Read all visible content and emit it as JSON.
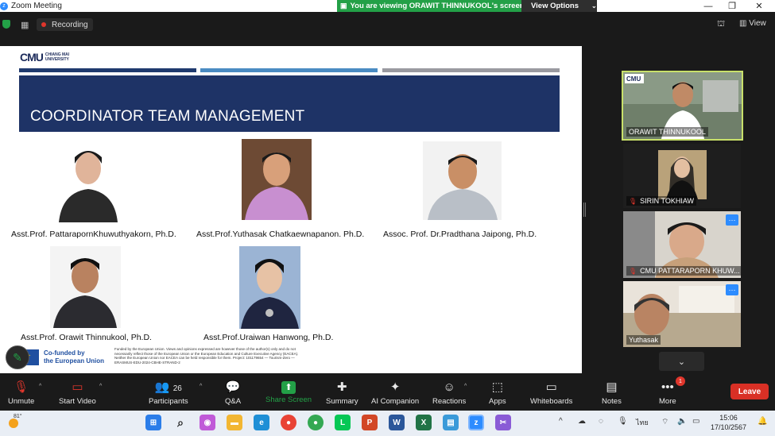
{
  "titlebar": {
    "title": "Zoom Meeting",
    "viewing_banner": "You are viewing ORAWIT THINNUKOOL's screen",
    "view_options": "View Options"
  },
  "topbar": {
    "recording": "Recording",
    "view_label": "View"
  },
  "slide": {
    "logo_mark": "CMU",
    "logo_text_line1": "CHIANG MAI",
    "logo_text_line2": "UNIVERSITY",
    "title": "COORDINATOR TEAM MANAGEMENT",
    "people": [
      {
        "name": "Asst.Prof. PattarapornKhuwuthyakorn, Ph.D."
      },
      {
        "name": "Asst.Prof.Yuthasak Chatkaewnapanon. Ph.D."
      },
      {
        "name": "Assoc. Prof. Dr.Pradthana Jaipong, Ph.D."
      },
      {
        "name": "Asst.Prof. Orawit Thinnukool, Ph.D."
      },
      {
        "name": "Asst.Prof.Uraiwan Hanwong, Ph.D."
      }
    ],
    "footer": {
      "cofunded_line1": "Co-funded by",
      "cofunded_line2": "the European Union",
      "disclaimer": "Funded by the European Union. Views and opinions expressed are however those of the author(s) only and do not necessarily reflect those of the European Union or the European Education and Culture Executive Agency (EACEA). Neither the European Union nor EACEA can be held responsible for them. Project: 101179654 — Tourism-Zero — ERASMUS-EDU-2024-CBHE-STRAND-2"
    }
  },
  "participants": [
    {
      "name": "ORAWIT THINNUKOOL",
      "muted": false,
      "active": true
    },
    {
      "name": "SIRIN TOKHIAW",
      "muted": true,
      "active": false
    },
    {
      "name": "CMU PATTARAPORN KHUW...",
      "muted": true,
      "active": false
    },
    {
      "name": "Yuthasak",
      "muted": false,
      "active": false
    }
  ],
  "toolbar": {
    "unmute": "Unmute",
    "start_video": "Start Video",
    "participants": "Participants",
    "participants_count": "26",
    "qa": "Q&A",
    "share_screen": "Share Screen",
    "summary": "Summary",
    "ai_companion": "AI Companion",
    "reactions": "Reactions",
    "apps": "Apps",
    "whiteboards": "Whiteboards",
    "notes": "Notes",
    "more": "More",
    "more_badge": "1",
    "leave": "Leave"
  },
  "taskbar": {
    "weather_temp": "81°",
    "language": "ไทย",
    "time": "15:06",
    "date": "17/10/2567"
  },
  "colors": {
    "zoom_green": "#23a047",
    "leave_red": "#d93025",
    "slide_navy": "#1e3366",
    "zoom_blue": "#2d8cff"
  }
}
